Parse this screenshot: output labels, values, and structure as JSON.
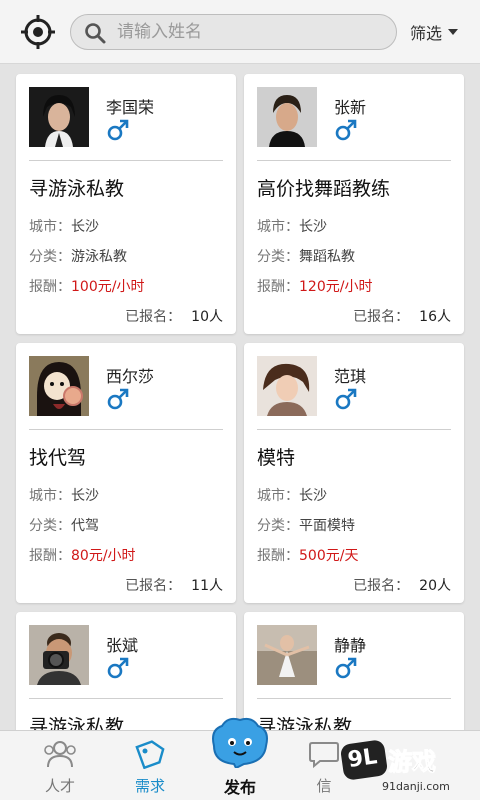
{
  "header": {
    "search_placeholder": "请输入姓名",
    "filter_label": "筛选"
  },
  "labels": {
    "city": "城市：",
    "category": "分类：",
    "pay": "报酬：",
    "signed_up": "已报名："
  },
  "cards": [
    {
      "name": "李国荣",
      "gender": "male",
      "title": "寻游泳私教",
      "city": "长沙",
      "category": "游泳私教",
      "pay": "100元/小时",
      "signups": "10人"
    },
    {
      "name": "张新",
      "gender": "male",
      "title": "高价找舞蹈教练",
      "city": "长沙",
      "category": "舞蹈私教",
      "pay": "120元/小时",
      "signups": "16人"
    },
    {
      "name": "西尔莎",
      "gender": "male",
      "title": "找代驾",
      "city": "长沙",
      "category": "代驾",
      "pay": "80元/小时",
      "signups": "11人"
    },
    {
      "name": "范琪",
      "gender": "male",
      "title": "模特",
      "city": "长沙",
      "category": "平面模特",
      "pay": "500元/天",
      "signups": "20人"
    },
    {
      "name": "张斌",
      "gender": "male",
      "title": "寻游泳私教"
    },
    {
      "name": "静静",
      "gender": "male",
      "title": "寻游泳私教"
    }
  ],
  "tabs": [
    {
      "label": "人才",
      "icon": "people-icon"
    },
    {
      "label": "需求",
      "icon": "tag-icon"
    },
    {
      "label": "发布",
      "icon": "publish-bubble-icon"
    },
    {
      "label": "信",
      "icon": "message-icon"
    }
  ],
  "watermark": {
    "badge": "9L",
    "text": "游戏",
    "url": "91danji.com"
  },
  "colors": {
    "accent": "#1a8cc9",
    "pay": "#d01818",
    "gender_icon": "#1a78c2"
  }
}
